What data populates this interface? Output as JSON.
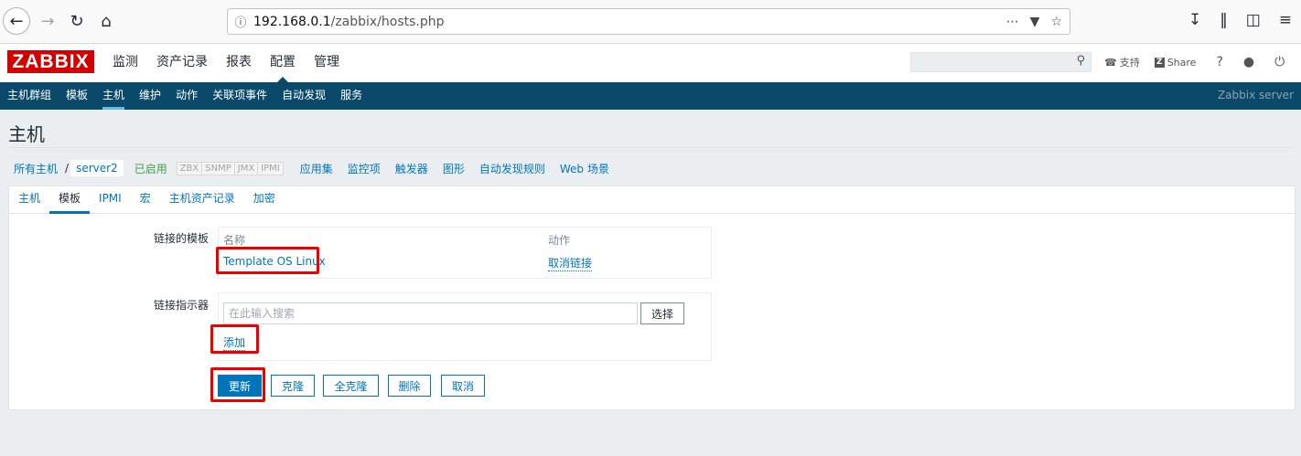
{
  "browser": {
    "url_host": "192.168.0.1",
    "url_path": "/zabbix/hosts.php"
  },
  "header": {
    "logo": "ZABBIX",
    "menu": [
      "监测",
      "资产记录",
      "报表",
      "配置",
      "管理"
    ],
    "support": "支持",
    "share": "Share",
    "help": "?",
    "search_value": ""
  },
  "submenu": {
    "items": [
      "主机群组",
      "模板",
      "主机",
      "维护",
      "动作",
      "关联项事件",
      "自动发现",
      "服务"
    ],
    "server": "Zabbix server"
  },
  "page": {
    "title": "主机"
  },
  "host_nav": {
    "all_hosts": "所有主机",
    "separator": "/",
    "host": "server2",
    "status": "已启用",
    "availability": [
      "ZBX",
      "SNMP",
      "JMX",
      "IPMI"
    ],
    "links": [
      "应用集",
      "监控项",
      "触发器",
      "图形",
      "自动发现规则",
      "Web 场景"
    ]
  },
  "tabs": [
    "主机",
    "模板",
    "IPMI",
    "宏",
    "主机资产记录",
    "加密"
  ],
  "form": {
    "linked_templates_label": "链接的模板",
    "col_name": "名称",
    "col_action": "动作",
    "template_name": "Template OS Linux",
    "unlink": "取消链接",
    "link_new_label": "链接指示器",
    "search_placeholder": "在此输入搜索",
    "select": "选择",
    "add": "添加"
  },
  "buttons": {
    "update": "更新",
    "clone": "克隆",
    "full_clone": "全克隆",
    "delete": "删除",
    "cancel": "取消"
  },
  "colors": {
    "brand_red": "#d40000",
    "nav_blue": "#0b496a",
    "link_blue": "#0275b8",
    "highlight_red": "#ef0000"
  }
}
